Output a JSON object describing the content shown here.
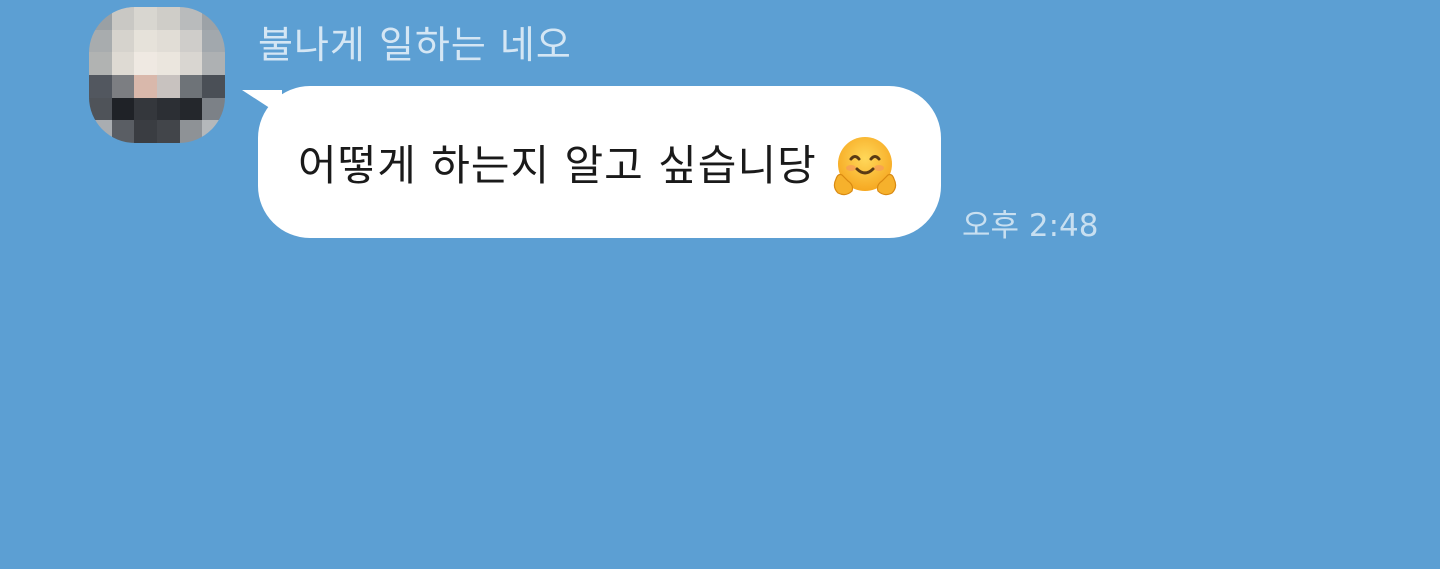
{
  "chat": {
    "sender_name": "불나게 일하는 네오",
    "message": {
      "text": "어떻게 하는지 알고 싶습니당",
      "emoji": "hugging-face-emoji",
      "time": "오후 2:48"
    }
  },
  "colors": {
    "background": "#5c9fd3",
    "bubble": "#ffffff",
    "sender_name": "#d4e6f4",
    "timestamp": "#c8dff0",
    "message_text": "#1a1a1a"
  }
}
